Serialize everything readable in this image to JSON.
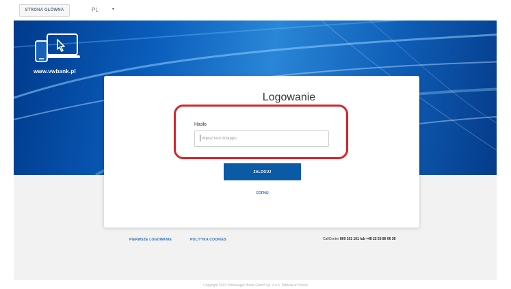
{
  "topbar": {
    "home_tab": "STRONA GŁÓWNA",
    "language": "PL",
    "language_caret": "▾"
  },
  "hero": {
    "url": "www.vwbank.pl"
  },
  "login": {
    "title": "Logowanie",
    "password_label": "Hasło",
    "password_placeholder": "Wpisz kod dostępu",
    "submit_label": "ZALOGUJ",
    "cancel_label": "COFNIJ"
  },
  "footer": {
    "first_login": "PIERWSZE LOGOWANIE",
    "cookies_policy": "POLITYKA COOKIES",
    "callcenter_prefix": "CallCenter",
    "callcenter_numbers": "800 101 101 lub +48 22 53 86 06 38",
    "copyright": "Copyright 2019 Volkswagen Bank GmbH Sp. z o.o. Oddział w Polsce"
  },
  "colors": {
    "brand_blue": "#0b5aa6",
    "highlight_red": "#d7232a",
    "link_blue": "#2a6fb5"
  }
}
